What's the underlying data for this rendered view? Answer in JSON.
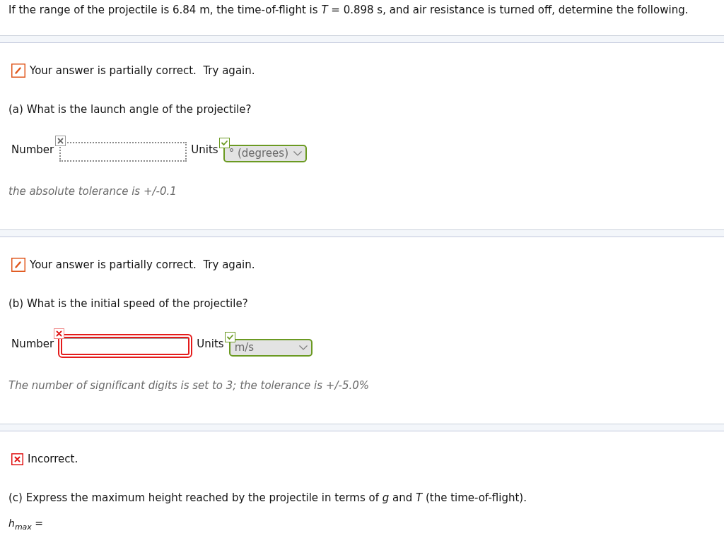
{
  "intro": "If the range of the projectile is 6.84 m, the time-of-flight is *T* = 0.898 s, and air resistance is turned off, determine the following.",
  "parts": [
    {
      "kind": "numeric",
      "status": {
        "kind": "partial",
        "text": "Your answer is partially correct.  Try again."
      },
      "question": "(a) What is the launch angle of the projectile?",
      "number": {
        "label": "Number",
        "answered": false,
        "correct": false
      },
      "units": {
        "label": "Units",
        "value": "° (degrees)",
        "correct": true
      },
      "note": "the absolute tolerance is +/-0.1"
    },
    {
      "kind": "numeric",
      "status": {
        "kind": "partial",
        "text": "Your answer is partially correct.  Try again."
      },
      "question": "(b) What is the initial speed of the projectile?",
      "number": {
        "label": "Number",
        "answered": true,
        "correct": false
      },
      "units": {
        "label": "Units",
        "value": "m/s",
        "correct": true
      },
      "note": "The number of significant digits is set to 3; the tolerance is +/-5.0%"
    },
    {
      "kind": "expression",
      "status": {
        "kind": "incorrect",
        "text": "Incorrect."
      },
      "question": "(c) Express the maximum height reached by the projectile in terms of *g* and *T* (the time-of-flight).",
      "answer_label": "*h*$_{max}$ ="
    }
  ]
}
